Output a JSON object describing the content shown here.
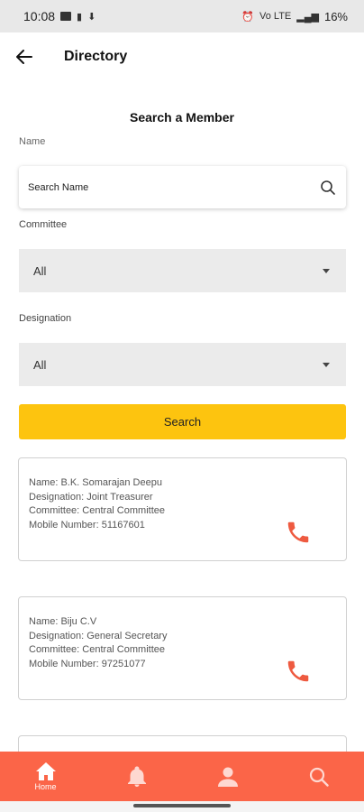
{
  "status_bar": {
    "time": "10:08",
    "battery": "16%",
    "signal_text": "Vo LTE"
  },
  "header": {
    "title": "Directory",
    "back_icon": "arrow-left-icon"
  },
  "search_section": {
    "title": "Search a Member",
    "name_label": "Name",
    "name_placeholder": "Search Name",
    "name_value": "",
    "committee_label": "Committee",
    "committee_value": "All",
    "designation_label": "Designation",
    "designation_value": "All",
    "search_button": "Search"
  },
  "members": [
    {
      "name": "Name: B.K. Somarajan Deepu",
      "designation": "Designation: Joint Treasurer",
      "committee": "Committee: Central Committee",
      "mobile": "Mobile Number: 51167601"
    },
    {
      "name": "Name: Biju C.V",
      "designation": "Designation: General Secretary",
      "committee": "Committee: Central Committee",
      "mobile": "Mobile Number: 97251077"
    }
  ],
  "bottom_nav": {
    "home_label": "Home"
  },
  "colors": {
    "accent_yellow": "#fdc40f",
    "nav_orange": "#fb6548",
    "phone_icon": "#ee5a40",
    "select_bg": "#ebebeb"
  }
}
